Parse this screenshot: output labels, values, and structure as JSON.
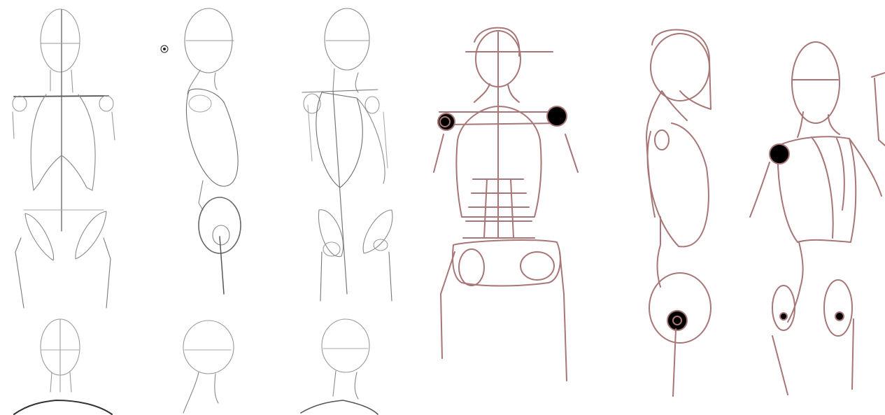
{
  "colors": {
    "pencil": "#6e6e6e",
    "pencil_light": "#b4b4b4",
    "overlay": "#a87676",
    "background": "#ffffff",
    "rule": "#9a9a9a"
  },
  "icons": {
    "cursor": "target-cursor-icon"
  }
}
